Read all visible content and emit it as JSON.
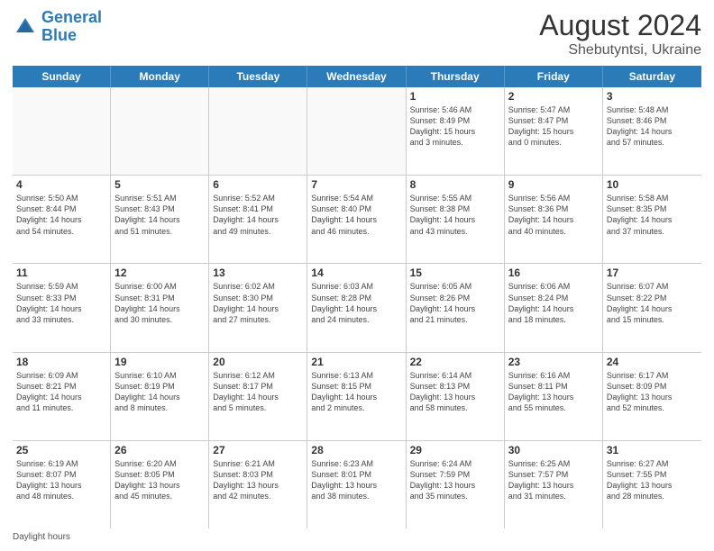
{
  "logo": {
    "line1": "General",
    "line2": "Blue"
  },
  "title": "August 2024",
  "subtitle": "Shebutyntsi, Ukraine",
  "days_of_week": [
    "Sunday",
    "Monday",
    "Tuesday",
    "Wednesday",
    "Thursday",
    "Friday",
    "Saturday"
  ],
  "weeks": [
    [
      {
        "day": "",
        "info": ""
      },
      {
        "day": "",
        "info": ""
      },
      {
        "day": "",
        "info": ""
      },
      {
        "day": "",
        "info": ""
      },
      {
        "day": "1",
        "info": "Sunrise: 5:46 AM\nSunset: 8:49 PM\nDaylight: 15 hours\nand 3 minutes."
      },
      {
        "day": "2",
        "info": "Sunrise: 5:47 AM\nSunset: 8:47 PM\nDaylight: 15 hours\nand 0 minutes."
      },
      {
        "day": "3",
        "info": "Sunrise: 5:48 AM\nSunset: 8:46 PM\nDaylight: 14 hours\nand 57 minutes."
      }
    ],
    [
      {
        "day": "4",
        "info": "Sunrise: 5:50 AM\nSunset: 8:44 PM\nDaylight: 14 hours\nand 54 minutes."
      },
      {
        "day": "5",
        "info": "Sunrise: 5:51 AM\nSunset: 8:43 PM\nDaylight: 14 hours\nand 51 minutes."
      },
      {
        "day": "6",
        "info": "Sunrise: 5:52 AM\nSunset: 8:41 PM\nDaylight: 14 hours\nand 49 minutes."
      },
      {
        "day": "7",
        "info": "Sunrise: 5:54 AM\nSunset: 8:40 PM\nDaylight: 14 hours\nand 46 minutes."
      },
      {
        "day": "8",
        "info": "Sunrise: 5:55 AM\nSunset: 8:38 PM\nDaylight: 14 hours\nand 43 minutes."
      },
      {
        "day": "9",
        "info": "Sunrise: 5:56 AM\nSunset: 8:36 PM\nDaylight: 14 hours\nand 40 minutes."
      },
      {
        "day": "10",
        "info": "Sunrise: 5:58 AM\nSunset: 8:35 PM\nDaylight: 14 hours\nand 37 minutes."
      }
    ],
    [
      {
        "day": "11",
        "info": "Sunrise: 5:59 AM\nSunset: 8:33 PM\nDaylight: 14 hours\nand 33 minutes."
      },
      {
        "day": "12",
        "info": "Sunrise: 6:00 AM\nSunset: 8:31 PM\nDaylight: 14 hours\nand 30 minutes."
      },
      {
        "day": "13",
        "info": "Sunrise: 6:02 AM\nSunset: 8:30 PM\nDaylight: 14 hours\nand 27 minutes."
      },
      {
        "day": "14",
        "info": "Sunrise: 6:03 AM\nSunset: 8:28 PM\nDaylight: 14 hours\nand 24 minutes."
      },
      {
        "day": "15",
        "info": "Sunrise: 6:05 AM\nSunset: 8:26 PM\nDaylight: 14 hours\nand 21 minutes."
      },
      {
        "day": "16",
        "info": "Sunrise: 6:06 AM\nSunset: 8:24 PM\nDaylight: 14 hours\nand 18 minutes."
      },
      {
        "day": "17",
        "info": "Sunrise: 6:07 AM\nSunset: 8:22 PM\nDaylight: 14 hours\nand 15 minutes."
      }
    ],
    [
      {
        "day": "18",
        "info": "Sunrise: 6:09 AM\nSunset: 8:21 PM\nDaylight: 14 hours\nand 11 minutes."
      },
      {
        "day": "19",
        "info": "Sunrise: 6:10 AM\nSunset: 8:19 PM\nDaylight: 14 hours\nand 8 minutes."
      },
      {
        "day": "20",
        "info": "Sunrise: 6:12 AM\nSunset: 8:17 PM\nDaylight: 14 hours\nand 5 minutes."
      },
      {
        "day": "21",
        "info": "Sunrise: 6:13 AM\nSunset: 8:15 PM\nDaylight: 14 hours\nand 2 minutes."
      },
      {
        "day": "22",
        "info": "Sunrise: 6:14 AM\nSunset: 8:13 PM\nDaylight: 13 hours\nand 58 minutes."
      },
      {
        "day": "23",
        "info": "Sunrise: 6:16 AM\nSunset: 8:11 PM\nDaylight: 13 hours\nand 55 minutes."
      },
      {
        "day": "24",
        "info": "Sunrise: 6:17 AM\nSunset: 8:09 PM\nDaylight: 13 hours\nand 52 minutes."
      }
    ],
    [
      {
        "day": "25",
        "info": "Sunrise: 6:19 AM\nSunset: 8:07 PM\nDaylight: 13 hours\nand 48 minutes."
      },
      {
        "day": "26",
        "info": "Sunrise: 6:20 AM\nSunset: 8:05 PM\nDaylight: 13 hours\nand 45 minutes."
      },
      {
        "day": "27",
        "info": "Sunrise: 6:21 AM\nSunset: 8:03 PM\nDaylight: 13 hours\nand 42 minutes."
      },
      {
        "day": "28",
        "info": "Sunrise: 6:23 AM\nSunset: 8:01 PM\nDaylight: 13 hours\nand 38 minutes."
      },
      {
        "day": "29",
        "info": "Sunrise: 6:24 AM\nSunset: 7:59 PM\nDaylight: 13 hours\nand 35 minutes."
      },
      {
        "day": "30",
        "info": "Sunrise: 6:25 AM\nSunset: 7:57 PM\nDaylight: 13 hours\nand 31 minutes."
      },
      {
        "day": "31",
        "info": "Sunrise: 6:27 AM\nSunset: 7:55 PM\nDaylight: 13 hours\nand 28 minutes."
      }
    ]
  ],
  "footer": "Daylight hours"
}
